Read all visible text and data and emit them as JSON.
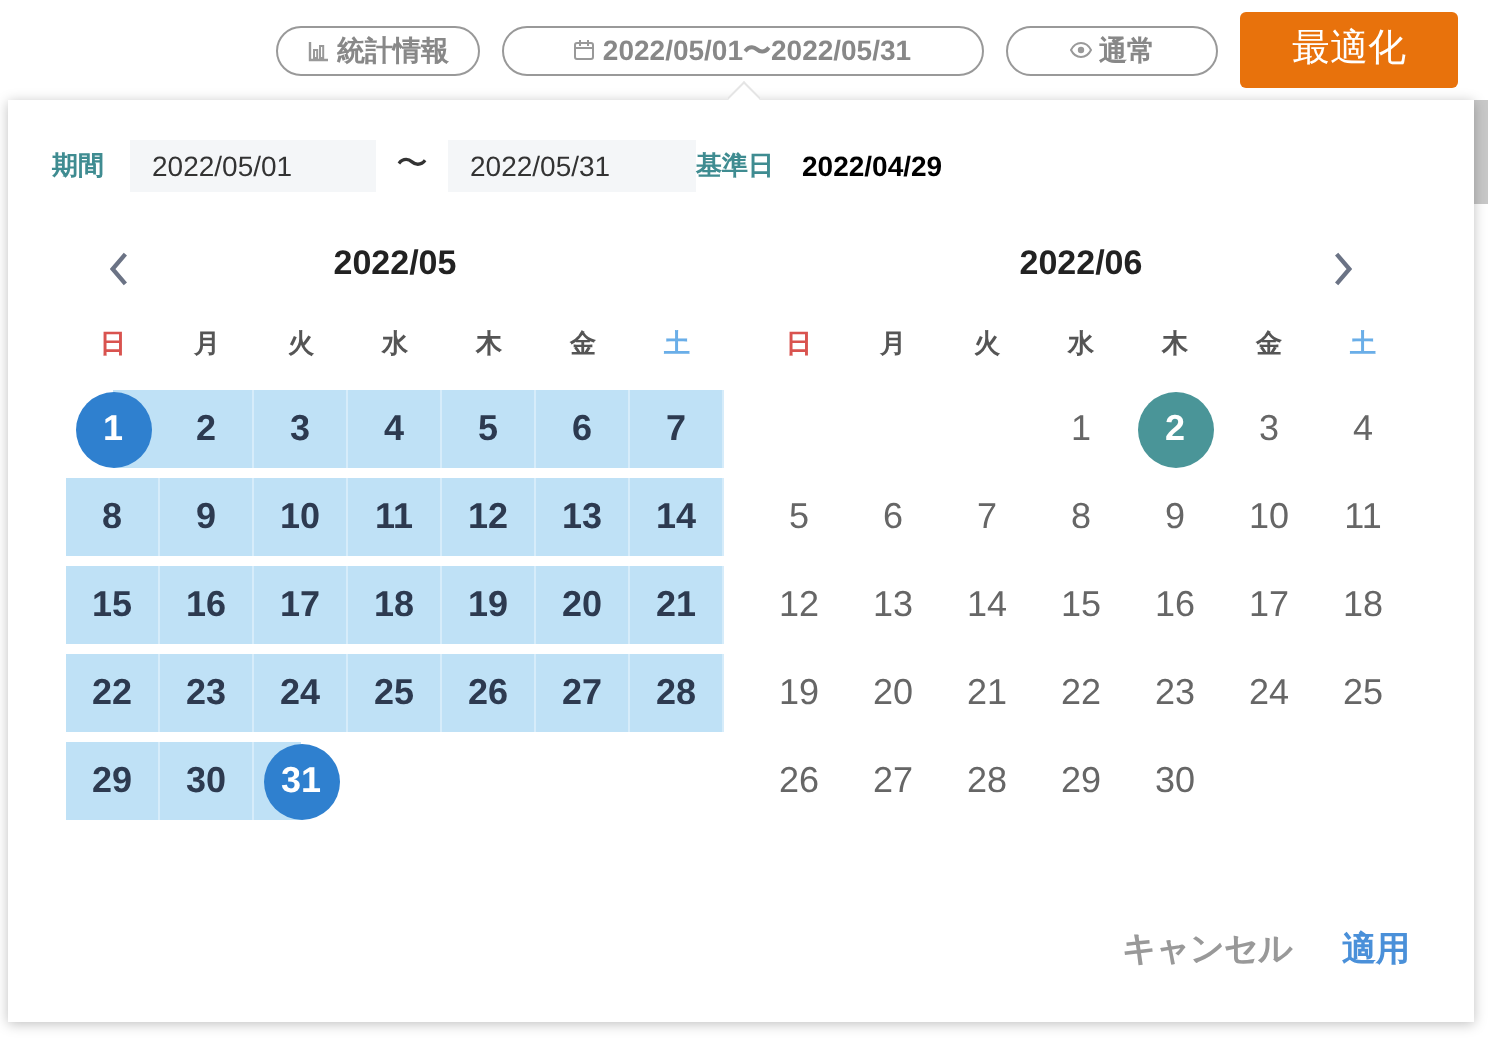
{
  "toolbar": {
    "buttons": [
      {
        "kind": "stats",
        "label": "統計情報"
      },
      {
        "kind": "date",
        "label": "2022/05/01〜2022/05/31"
      },
      {
        "kind": "view",
        "label": "通常"
      },
      {
        "kind": "primary",
        "label": "最適化"
      }
    ]
  },
  "popup": {
    "period_label": "期間",
    "start_value": "2022/05/01",
    "separator": "〜",
    "end_value": "2022/05/31",
    "base_label": "基準日",
    "base_value": "2022/04/29",
    "months": [
      {
        "title": "2022/05",
        "kind": "first",
        "bold_days": true,
        "weekdays": [
          {
            "label": "日",
            "color": "#d9534f"
          },
          {
            "label": "月",
            "color": "#555555"
          },
          {
            "label": "火",
            "color": "#555555"
          },
          {
            "label": "水",
            "color": "#555555"
          },
          {
            "label": "木",
            "color": "#555555"
          },
          {
            "label": "金",
            "color": "#555555"
          },
          {
            "label": "土",
            "color": "#6aaee8"
          }
        ],
        "weeks": [
          {
            "days": [
              {
                "label": "1",
                "kind": "endpoint"
              },
              {
                "label": "2",
                "kind": "range"
              },
              {
                "label": "3",
                "kind": "range"
              },
              {
                "label": "4",
                "kind": "range"
              },
              {
                "label": "5",
                "kind": "range"
              },
              {
                "label": "6",
                "kind": "range"
              },
              {
                "label": "7",
                "kind": "range"
              }
            ]
          },
          {
            "days": [
              {
                "label": "8",
                "kind": "range"
              },
              {
                "label": "9",
                "kind": "range"
              },
              {
                "label": "10",
                "kind": "range"
              },
              {
                "label": "11",
                "kind": "range"
              },
              {
                "label": "12",
                "kind": "range"
              },
              {
                "label": "13",
                "kind": "range"
              },
              {
                "label": "14",
                "kind": "range"
              }
            ]
          },
          {
            "days": [
              {
                "label": "15",
                "kind": "range"
              },
              {
                "label": "16",
                "kind": "range"
              },
              {
                "label": "17",
                "kind": "range"
              },
              {
                "label": "18",
                "kind": "range"
              },
              {
                "label": "19",
                "kind": "range"
              },
              {
                "label": "20",
                "kind": "range"
              },
              {
                "label": "21",
                "kind": "range"
              }
            ]
          },
          {
            "days": [
              {
                "label": "22",
                "kind": "range"
              },
              {
                "label": "23",
                "kind": "range"
              },
              {
                "label": "24",
                "kind": "range"
              },
              {
                "label": "25",
                "kind": "range"
              },
              {
                "label": "26",
                "kind": "range"
              },
              {
                "label": "27",
                "kind": "range"
              },
              {
                "label": "28",
                "kind": "range"
              }
            ]
          },
          {
            "align_end": false,
            "days": [
              {
                "label": "29",
                "kind": "range"
              },
              {
                "label": "30",
                "kind": "range"
              },
              {
                "label": "31",
                "kind": "endpoint"
              }
            ]
          }
        ]
      },
      {
        "title": "2022/06",
        "kind": "last",
        "bold_days": false,
        "weekdays": [
          {
            "label": "日",
            "color": "#d9534f"
          },
          {
            "label": "月",
            "color": "#555555"
          },
          {
            "label": "火",
            "color": "#555555"
          },
          {
            "label": "水",
            "color": "#555555"
          },
          {
            "label": "木",
            "color": "#555555"
          },
          {
            "label": "金",
            "color": "#555555"
          },
          {
            "label": "土",
            "color": "#6aaee8"
          }
        ],
        "weeks": [
          {
            "align_end": true,
            "days": [
              {
                "label": "1",
                "kind": "plain"
              },
              {
                "label": "2",
                "kind": "today"
              },
              {
                "label": "3",
                "kind": "plain"
              },
              {
                "label": "4",
                "kind": "plain"
              }
            ]
          },
          {
            "days": [
              {
                "label": "5",
                "kind": "plain"
              },
              {
                "label": "6",
                "kind": "plain"
              },
              {
                "label": "7",
                "kind": "plain"
              },
              {
                "label": "8",
                "kind": "plain"
              },
              {
                "label": "9",
                "kind": "plain"
              },
              {
                "label": "10",
                "kind": "plain"
              },
              {
                "label": "11",
                "kind": "plain"
              }
            ]
          },
          {
            "days": [
              {
                "label": "12",
                "kind": "plain"
              },
              {
                "label": "13",
                "kind": "plain"
              },
              {
                "label": "14",
                "kind": "plain"
              },
              {
                "label": "15",
                "kind": "plain"
              },
              {
                "label": "16",
                "kind": "plain"
              },
              {
                "label": "17",
                "kind": "plain"
              },
              {
                "label": "18",
                "kind": "plain"
              }
            ]
          },
          {
            "days": [
              {
                "label": "19",
                "kind": "plain"
              },
              {
                "label": "20",
                "kind": "plain"
              },
              {
                "label": "21",
                "kind": "plain"
              },
              {
                "label": "22",
                "kind": "plain"
              },
              {
                "label": "23",
                "kind": "plain"
              },
              {
                "label": "24",
                "kind": "plain"
              },
              {
                "label": "25",
                "kind": "plain"
              }
            ]
          },
          {
            "align_end": false,
            "days": [
              {
                "label": "26",
                "kind": "plain"
              },
              {
                "label": "27",
                "kind": "plain"
              },
              {
                "label": "28",
                "kind": "plain"
              },
              {
                "label": "29",
                "kind": "plain"
              },
              {
                "label": "30",
                "kind": "plain"
              }
            ]
          }
        ]
      }
    ],
    "actions": [
      {
        "kind": "cancel",
        "label": "キャンセル"
      },
      {
        "kind": "apply",
        "label": "適用"
      }
    ]
  }
}
